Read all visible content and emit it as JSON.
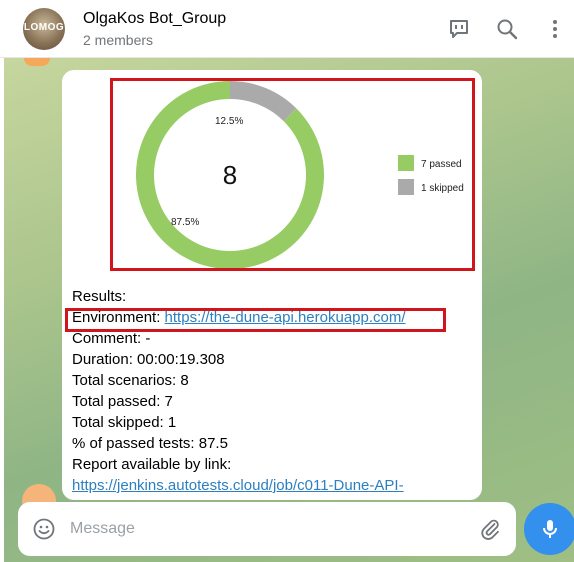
{
  "header": {
    "avatar_text": "LOMOG",
    "title": "OlgaKos Bot_Group",
    "subtitle": "2 members",
    "icons": [
      "bot-commands-icon",
      "search-icon",
      "more-vertical-icon"
    ]
  },
  "message": {
    "chart_data": {
      "type": "pie",
      "donut": true,
      "center_label": "8",
      "categories": [
        "7 passed",
        "1 skipped"
      ],
      "values": [
        87.5,
        12.5
      ],
      "slice_labels": [
        "87.5%",
        "12.5%"
      ],
      "colors": [
        "#97cc64",
        "#aaaaaa"
      ],
      "legend_position": "right"
    },
    "lines": [
      {
        "label": "Results:",
        "value": ""
      },
      {
        "label": "Environment: ",
        "value": "https://the-dune-api.herokuapp.com/"
      },
      {
        "label": "Comment: -",
        "value": ""
      },
      {
        "label": "Duration: 00:00:19.308",
        "value": ""
      },
      {
        "label": "Total scenarios: 8",
        "value": ""
      },
      {
        "label": "Total passed: 7",
        "value": ""
      },
      {
        "label": "Total skipped: 1",
        "value": ""
      },
      {
        "label": "% of passed tests: 87.5",
        "value": ""
      },
      {
        "label": "Report available by link:",
        "value": ""
      },
      {
        "label": "",
        "value": "https://jenkins.autotests.cloud/job/c011-Dune-API-"
      }
    ]
  },
  "composer": {
    "placeholder": "Message"
  },
  "colors": {
    "accent": "#3390ec",
    "highlight_box": "#d0151d",
    "link": "#2c7fc0"
  }
}
